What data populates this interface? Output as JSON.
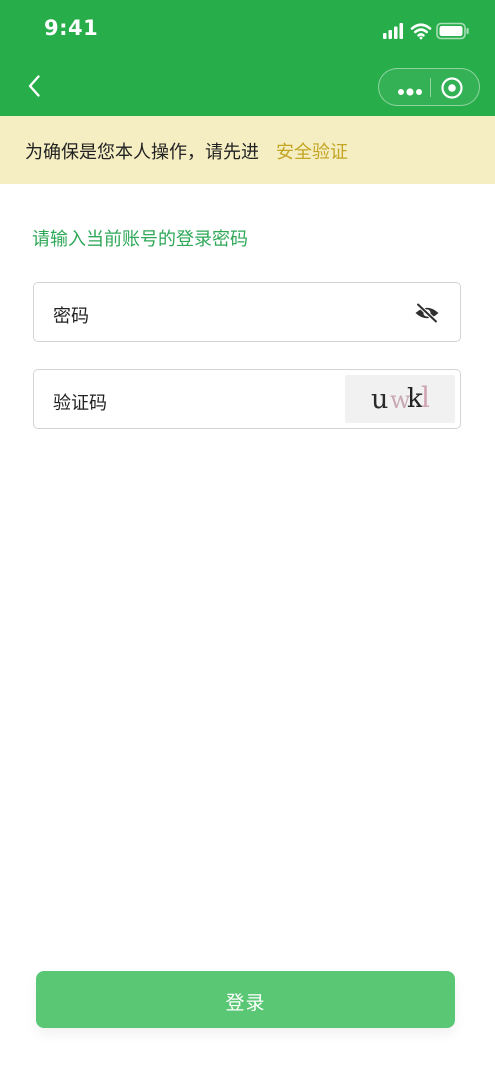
{
  "status_bar": {
    "time": "9:41",
    "icons": [
      "signal-icon",
      "wifi-icon",
      "battery-icon"
    ]
  },
  "nav_bar": {
    "back_icon": "chevron-left-icon",
    "capsule_icons": [
      "more-dots-icon",
      "close-target-icon"
    ]
  },
  "notice": {
    "text": "为确保是您本人操作，请先进",
    "link": "安全验证"
  },
  "form": {
    "prompt": "请输入当前账号的登录密码",
    "password": {
      "placeholder": "密码",
      "value": "",
      "toggle_icon": "eye-hidden-icon"
    },
    "captcha": {
      "placeholder": "验证码",
      "value": "",
      "image_chars": [
        "u",
        "w",
        "k",
        "l"
      ]
    }
  },
  "login_button": {
    "label": "登录"
  },
  "colors": {
    "header_bg": "#27ad4a",
    "notice_bg": "#f5eec3",
    "notice_link": "#c3a523",
    "prompt": "#2fa858",
    "button_bg": "#5ac775",
    "field_border": "#d3d3d3"
  }
}
